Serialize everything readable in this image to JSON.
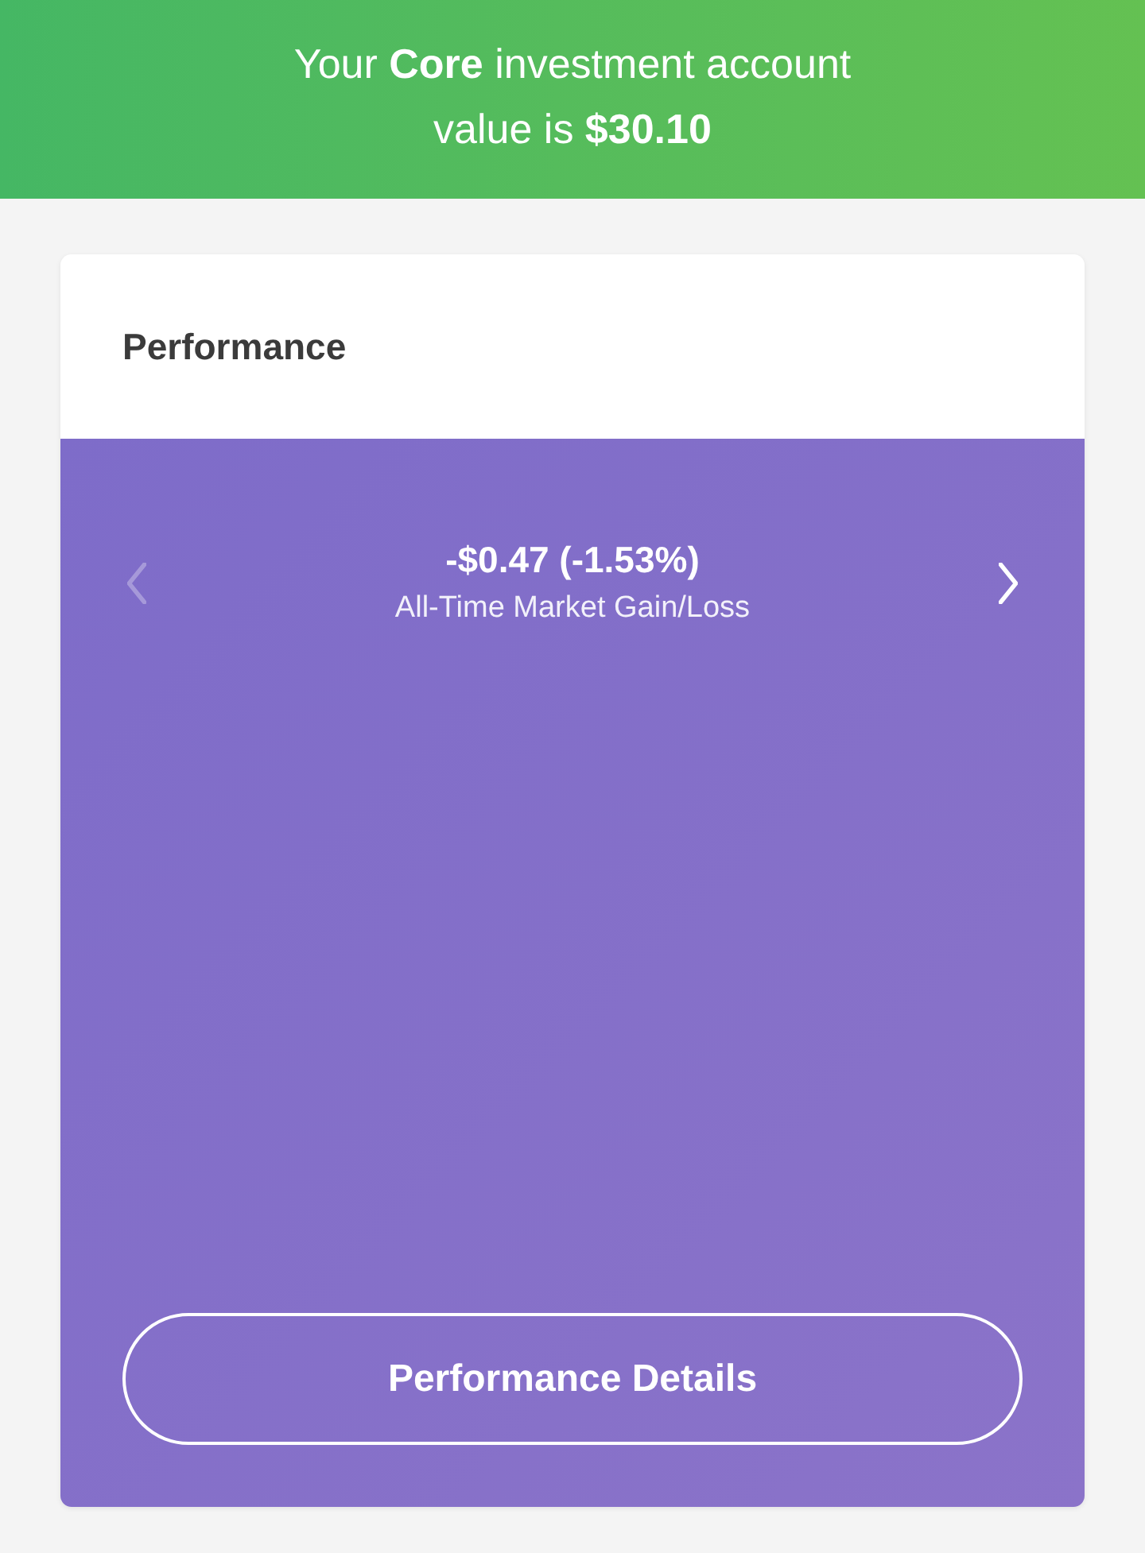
{
  "header": {
    "message": "Your **Core** investment account value is **$30.10**"
  },
  "performance_card": {
    "title": "Performance",
    "previous_button": {
      "disabled": true
    },
    "metric": {
      "value": "-$0.47 (-1.53%)",
      "label": "All-Time Market Gain/Loss"
    },
    "next_button": {
      "disabled": false
    },
    "details_button": {
      "label": "Performance Details"
    }
  }
}
